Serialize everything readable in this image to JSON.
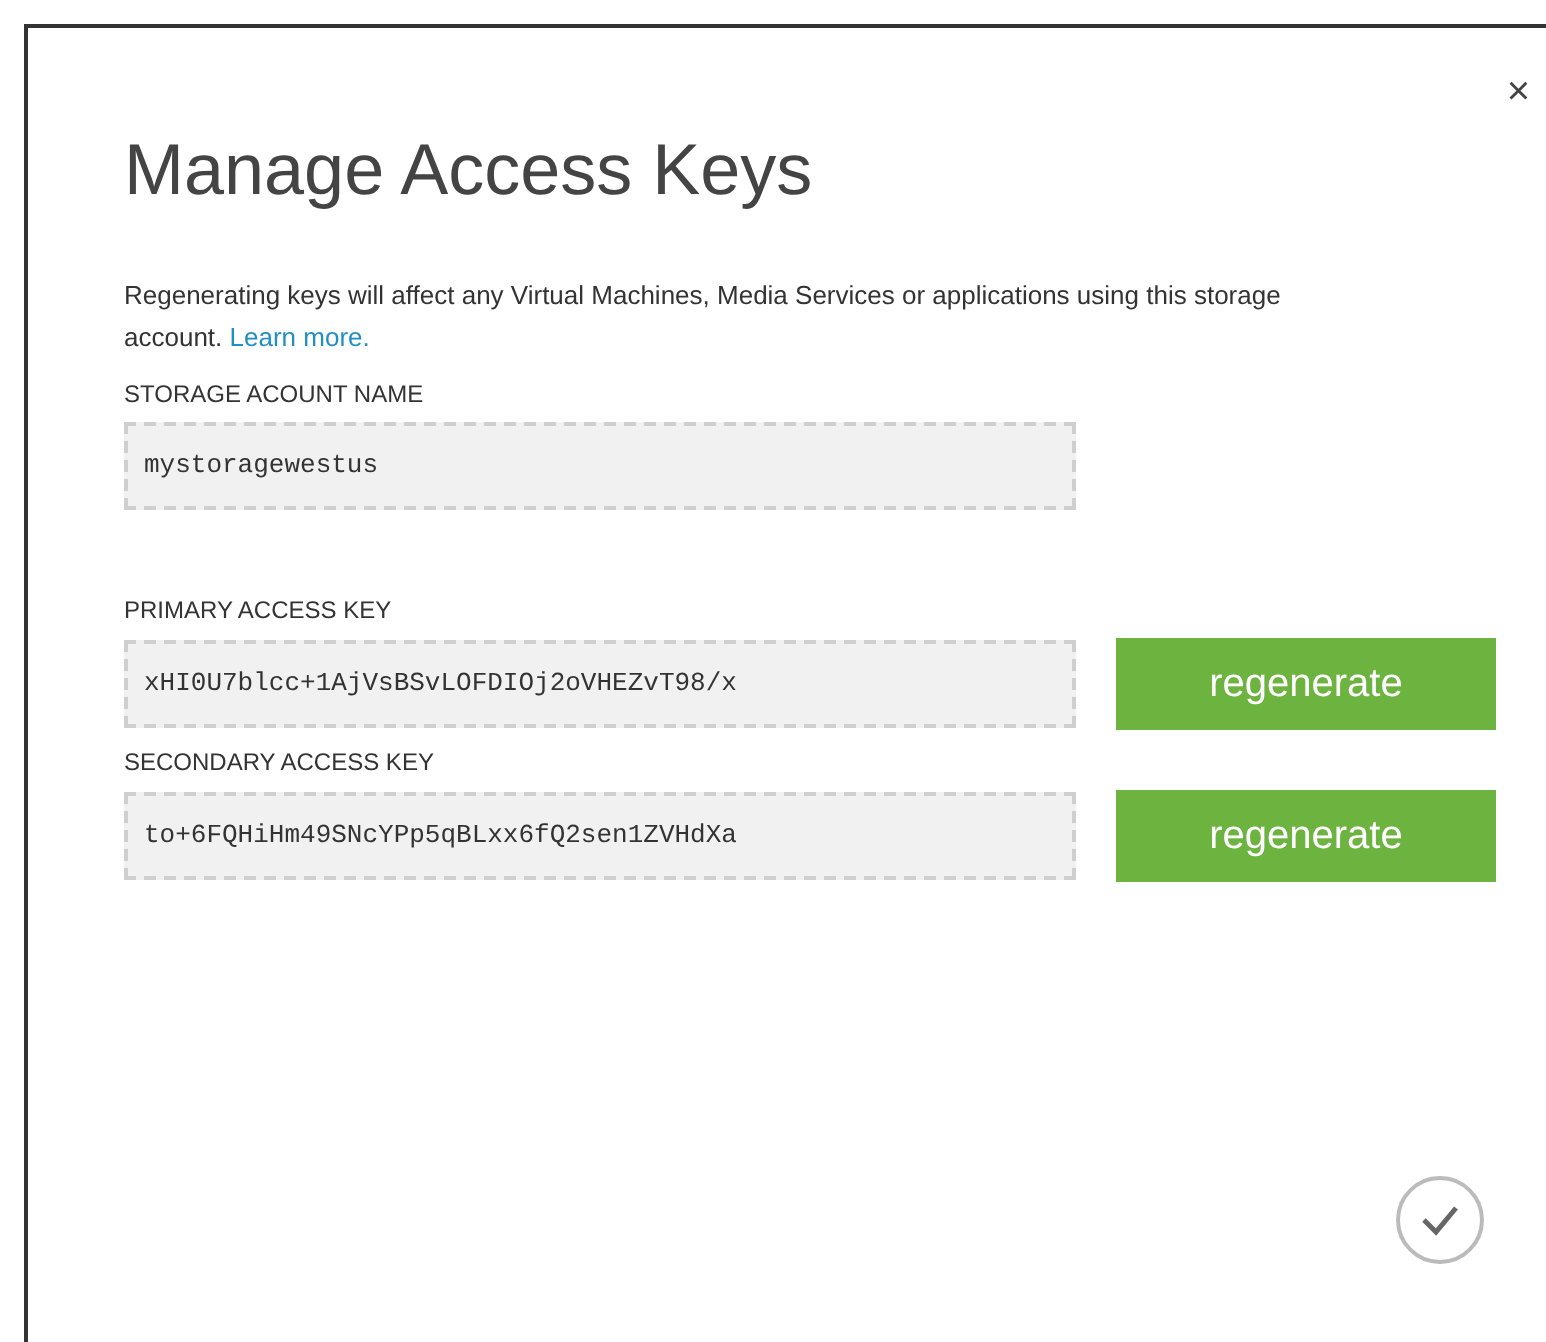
{
  "dialog": {
    "close": "×",
    "title": "Manage Access Keys",
    "description": "Regenerating keys will affect any Virtual Machines, Media Services or applications using this storage account.",
    "link": "Learn more.",
    "fields": [
      {
        "label": "STORAGE ACOUNT NAME",
        "value": "mystoragewestus"
      },
      {
        "label": "PRIMARY ACCESS KEY",
        "value": "xHI0U7blcc+1AjVsBSvLOFDIOj2oVHEZvT98/x",
        "button": "regenerate"
      },
      {
        "label": "SECONDARY ACCESS KEY",
        "value": "to+6FQHiHm49SNcYPp5qBLxx6fQ2sen1ZVHdXa",
        "button": "regenerate"
      }
    ]
  }
}
